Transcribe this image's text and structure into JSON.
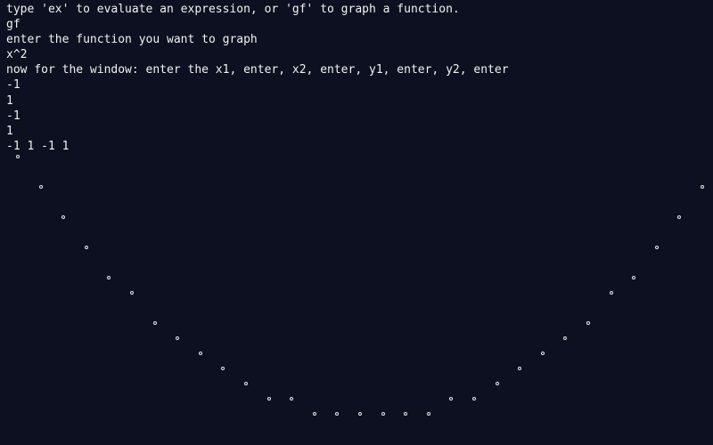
{
  "terminal": {
    "lines": [
      "type 'ex' to evaluate an expression, or 'gf' to graph a function.",
      "gf",
      "enter the function you want to graph",
      "x^2",
      "now for the window: enter the x1, enter, x2, enter, y1, enter, y2, enter",
      "-1",
      "1",
      "-1",
      "1",
      "-1 1 -1 1"
    ]
  },
  "plot": {
    "function": "x^2",
    "window": {
      "x1": -1,
      "x2": 1,
      "y1": -1,
      "y2": 1
    },
    "marker_glyph": "°",
    "marker_color": "#e8e8e8",
    "background_color": "#0c1020",
    "text_color": "#f2f2f2"
  }
}
